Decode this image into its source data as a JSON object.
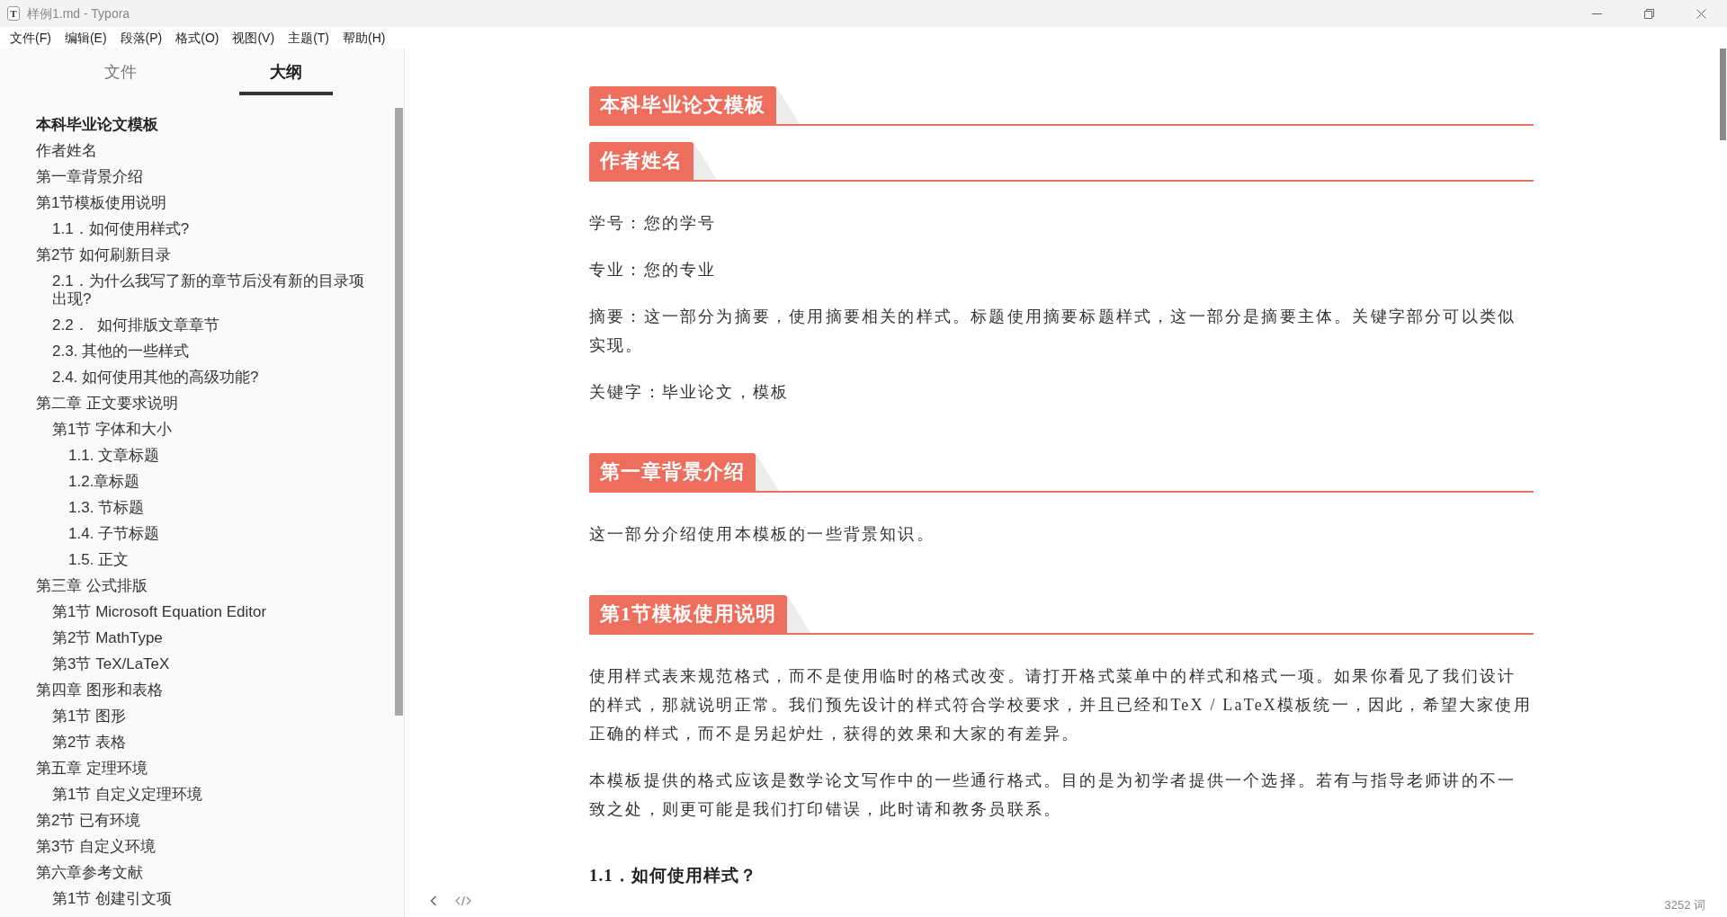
{
  "window": {
    "app_icon": "T",
    "title": "样例1.md - Typora"
  },
  "menu": [
    "文件(F)",
    "编辑(E)",
    "段落(P)",
    "格式(O)",
    "视图(V)",
    "主题(T)",
    "帮助(H)"
  ],
  "sidebar": {
    "tabs": [
      {
        "label": "文件",
        "selected": false
      },
      {
        "label": "大纲",
        "selected": true
      }
    ],
    "outline": [
      {
        "label": "本科毕业论文模板",
        "selected": true
      },
      {
        "label": "作者姓名",
        "selected": false
      },
      {
        "label": "第一章背景介绍",
        "selected": false
      },
      {
        "label": "第1节模板使用说明",
        "selected": false,
        "children": [
          {
            "label": "1.1．如何使用样式?",
            "selected": false
          }
        ]
      },
      {
        "label": "第2节 如何刷新目录",
        "selected": false,
        "children": [
          {
            "label": "2.1．为什么我写了新的章节后没有新的目录项出现?",
            "selected": false
          },
          {
            "label": "2.2．  如何排版文章章节",
            "selected": false
          },
          {
            "label": "2.3. 其他的一些样式",
            "selected": false
          },
          {
            "label": "2.4. 如何使用其他的高级功能?",
            "selected": false
          }
        ]
      },
      {
        "label": "第二章 正文要求说明",
        "selected": false,
        "children": [
          {
            "label": "第1节 字体和大小",
            "selected": false,
            "children": [
              {
                "label": "1.1. 文章标题",
                "selected": false
              },
              {
                "label": "1.2.章标题",
                "selected": false
              },
              {
                "label": "1.3. 节标题",
                "selected": false
              },
              {
                "label": "1.4. 子节标题",
                "selected": false
              },
              {
                "label": "1.5. 正文",
                "selected": false
              }
            ]
          }
        ]
      },
      {
        "label": "第三章 公式排版",
        "selected": false,
        "children": [
          {
            "label": "第1节 Microsoft Equation Editor",
            "selected": false
          },
          {
            "label": "第2节 MathType",
            "selected": false
          },
          {
            "label": "第3节 TeX/LaTeX",
            "selected": false
          }
        ]
      },
      {
        "label": "第四章 图形和表格",
        "selected": false,
        "children": [
          {
            "label": "第1节 图形",
            "selected": false
          },
          {
            "label": "第2节 表格",
            "selected": false
          }
        ]
      },
      {
        "label": "第五章 定理环境",
        "selected": false,
        "children": [
          {
            "label": "第1节 自定义定理环境",
            "selected": false
          }
        ]
      },
      {
        "label": "第2节 已有环境",
        "selected": false
      },
      {
        "label": "第3节 自定义环境",
        "selected": false
      },
      {
        "label": "第六章参考文献",
        "selected": false,
        "children": [
          {
            "label": "第1节 创建引文项",
            "selected": false
          }
        ]
      }
    ]
  },
  "document": [
    {
      "kind": "h1",
      "text": "本科毕业论文模板"
    },
    {
      "kind": "h1",
      "text": "作者姓名"
    },
    {
      "kind": "p",
      "text": "学号：您的学号"
    },
    {
      "kind": "p",
      "text": "专业：您的专业"
    },
    {
      "kind": "p",
      "text": "摘要：这一部分为摘要，使用摘要相关的样式。标题使用摘要标题样式，这一部分是摘要主体。关键字部分可以类似实现。"
    },
    {
      "kind": "p",
      "text": "关键字：毕业论文，模板"
    },
    {
      "kind": "h1",
      "text": "第一章背景介绍"
    },
    {
      "kind": "p",
      "text": "这一部分介绍使用本模板的一些背景知识。"
    },
    {
      "kind": "h1",
      "text": "第1节模板使用说明"
    },
    {
      "kind": "p",
      "text": "使用样式表来规范格式，而不是使用临时的格式改变。请打开格式菜单中的样式和格式一项。如果你看见了我们设计的样式，那就说明正常。我们预先设计的样式符合学校要求，并且已经和TeX / LaTeX模板统一，因此，希望大家使用正确的样式，而不是另起炉灶，获得的效果和大家的有差异。"
    },
    {
      "kind": "p",
      "text": "本模板提供的格式应该是数学论文写作中的一些通行格式。目的是为初学者提供一个选择。若有与指导老师讲的不一致之处，则更可能是我们打印错误，此时请和教务员联系。"
    },
    {
      "kind": "h3",
      "text": "1.1．如何使用样式？"
    }
  ],
  "status": {
    "word_count": "3252 词"
  }
}
